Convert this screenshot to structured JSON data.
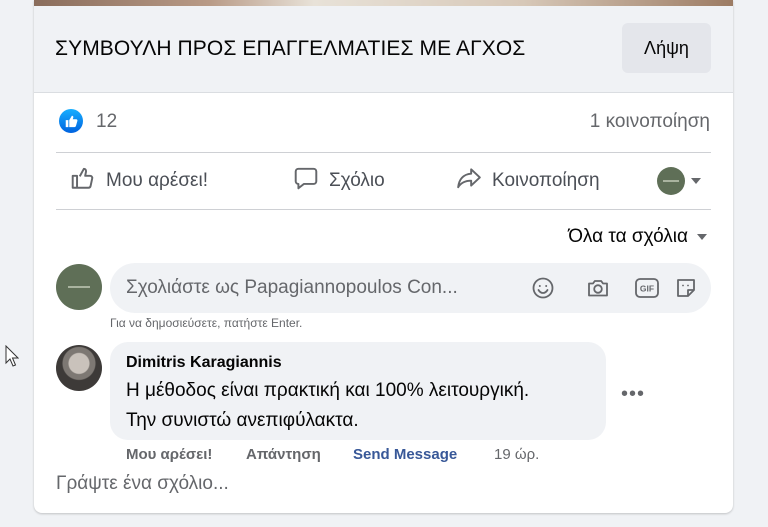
{
  "link": {
    "title": "ΣΥΜΒΟΥΛΗ ΠΡΟΣ ΕΠΑΓΓΕΛΜΑΤΙΕΣ ΜΕ ΑΓΧΟΣ",
    "cta_label": "Λήψη"
  },
  "stats": {
    "likes": "12",
    "shares": "1 κοινοποίηση"
  },
  "actions": {
    "like": "Μου αρέσει!",
    "comment": "Σχόλιο",
    "share": "Κοινοποίηση"
  },
  "comments": {
    "sort_label": "Όλα τα σχόλια",
    "input_placeholder": "Σχολιάστε ως Papagiannopoulos Con...",
    "post_hint": "Για να δημοσιεύσετε, πατήστε Enter.",
    "items": [
      {
        "author": "Dimitris Karagiannis",
        "text_line1": "Η μέθοδος είναι πρακτική και 100% λειτουργική.",
        "text_line2": "Την συνιστώ ανεπιφύλακτα.",
        "like_label": "Μου αρέσει!",
        "reply_label": "Απάντηση",
        "message_label": "Send Message",
        "time": "19 ώρ."
      }
    ],
    "write_prompt": "Γράψτε ένα σχόλιο..."
  },
  "colors": {
    "background": "#f0f2f5",
    "card": "#ffffff",
    "link_blue": "#385898",
    "muted": "#65676b"
  },
  "icons": [
    "like-badge-icon",
    "thumbs-up-icon",
    "comment-icon",
    "share-icon",
    "caret-down-icon",
    "emoji-icon",
    "camera-icon",
    "gif-icon",
    "sticker-icon",
    "more-icon",
    "cursor-icon"
  ]
}
